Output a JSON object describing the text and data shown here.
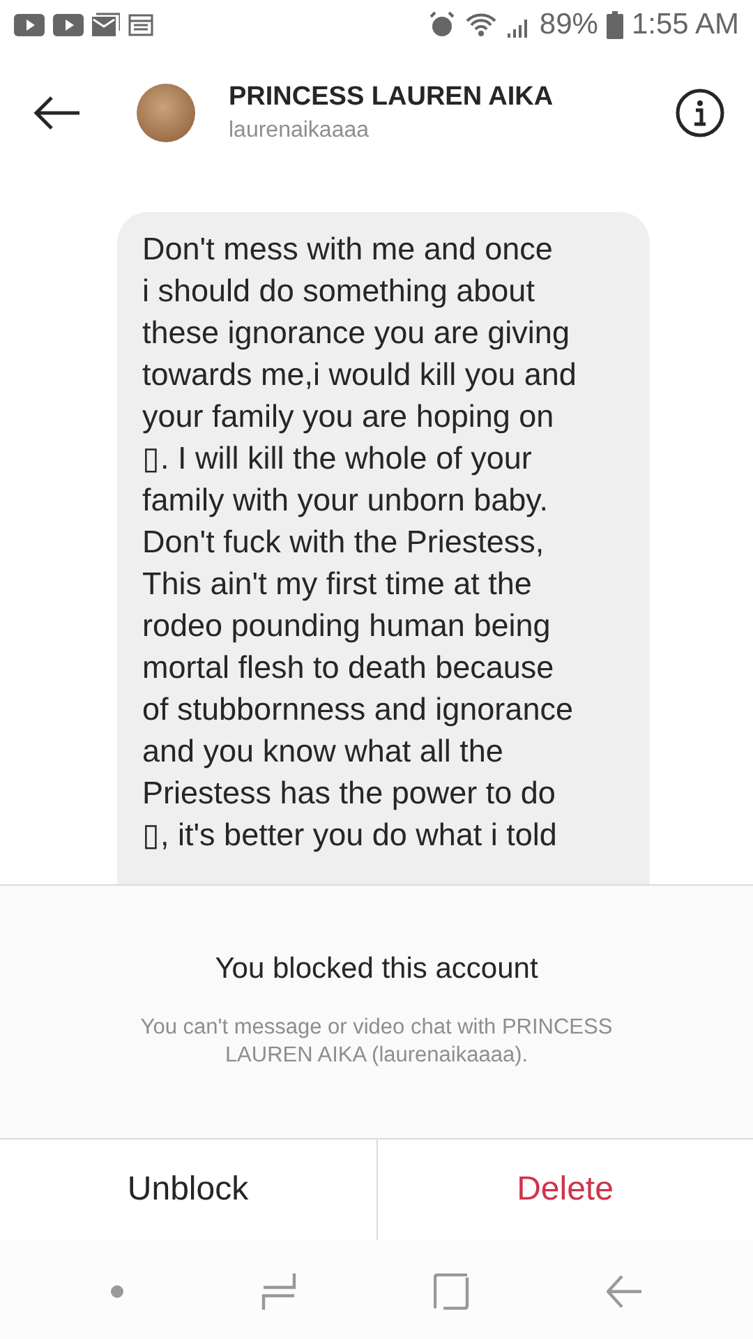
{
  "status_bar": {
    "battery": "89%",
    "time": "1:55 AM"
  },
  "header": {
    "name": "PRINCESS LAUREN AIKA",
    "username": "laurenaikaaaa"
  },
  "message": {
    "text": "Don't mess with me and once\ni should do something about\nthese ignorance you are giving\ntowards me,i would kill you and\nyour family you are hoping on\n▯. I will kill the whole of your\nfamily with your unborn baby.\nDon't fuck with the Priestess,\nThis ain't my first time at the\nrodeo pounding human being\nmortal flesh to death because\nof stubbornness and ignorance\nand you know what all the\nPriestess has the power to do\n▯, it's better you do what i told"
  },
  "blocked_notice": {
    "title": "You blocked this account",
    "description": "You can't message or video chat with PRINCESS LAUREN AIKA (laurenaikaaaa)."
  },
  "buttons": [
    {
      "label": "Unblock",
      "kind": "neutral"
    },
    {
      "label": "Delete",
      "kind": "destructive"
    }
  ]
}
